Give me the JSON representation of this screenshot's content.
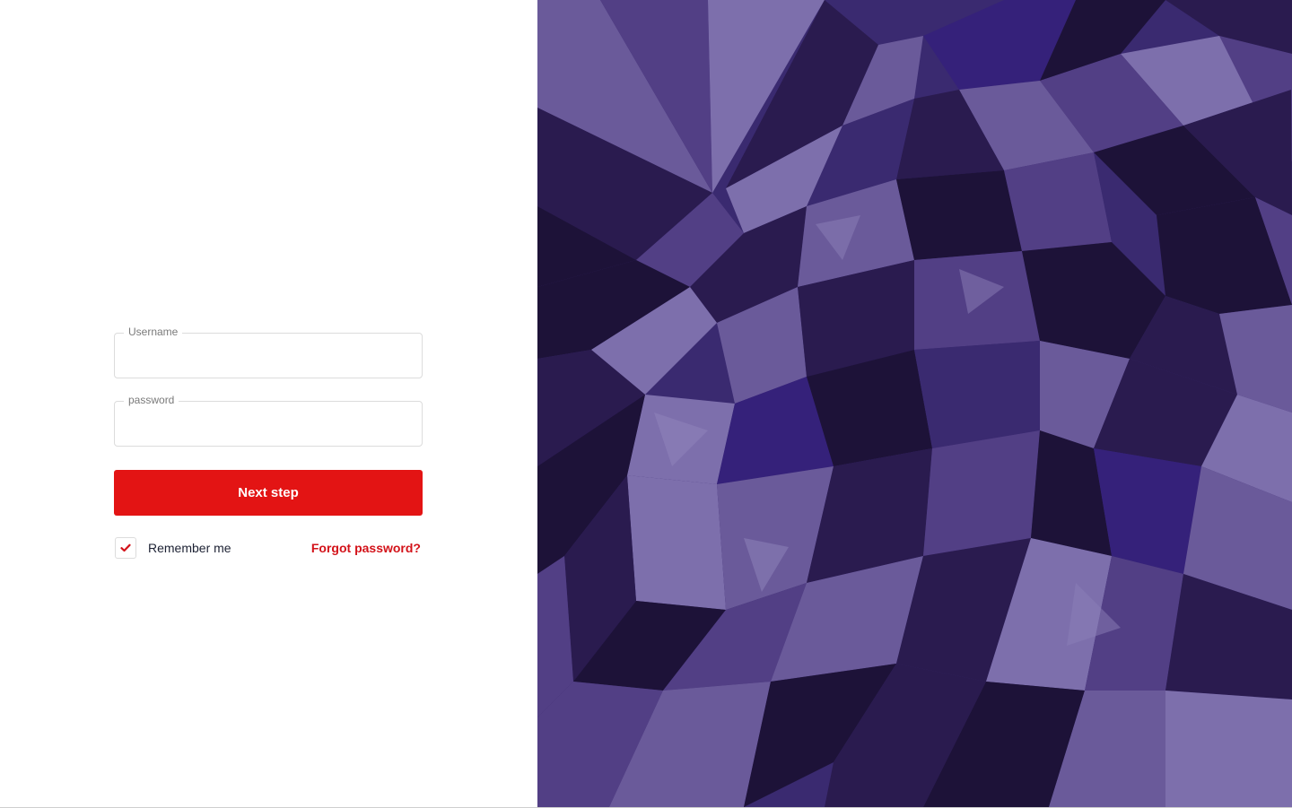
{
  "login_form": {
    "username": {
      "label": "Username",
      "value": "",
      "placeholder": ""
    },
    "password": {
      "label": "password",
      "value": "",
      "placeholder": ""
    },
    "submit_label": "Next step",
    "remember_me": {
      "label": "Remember me",
      "checked": true
    },
    "forgot_password_label": "Forgot password?"
  },
  "colors": {
    "primary": "#e31414",
    "link": "#d31219",
    "art_palette": [
      "#1d1238",
      "#2a1b4f",
      "#3a2a70",
      "#523f85",
      "#6a5a9a",
      "#7d6fac",
      "#35217a"
    ]
  },
  "icons": {
    "checkbox_mark": "checkmark-icon"
  }
}
